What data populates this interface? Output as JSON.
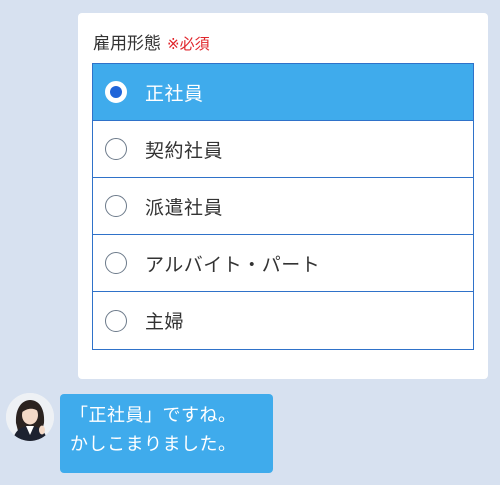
{
  "form": {
    "label": "雇用形態",
    "required": "※必須",
    "options": [
      {
        "label": "正社員",
        "selected": true
      },
      {
        "label": "契約社員",
        "selected": false
      },
      {
        "label": "派遣社員",
        "selected": false
      },
      {
        "label": "アルバイト・パート",
        "selected": false
      },
      {
        "label": "主婦",
        "selected": false
      }
    ]
  },
  "chat": {
    "avatar_icon": "operator-avatar",
    "message_lines": [
      "「正社員」ですね。",
      "かしこまりました。"
    ]
  },
  "colors": {
    "background": "#d7e1f0",
    "accent": "#3fabec",
    "border": "#2f72c9",
    "required": "#e0262c",
    "radio_selected": "#2064d8"
  }
}
